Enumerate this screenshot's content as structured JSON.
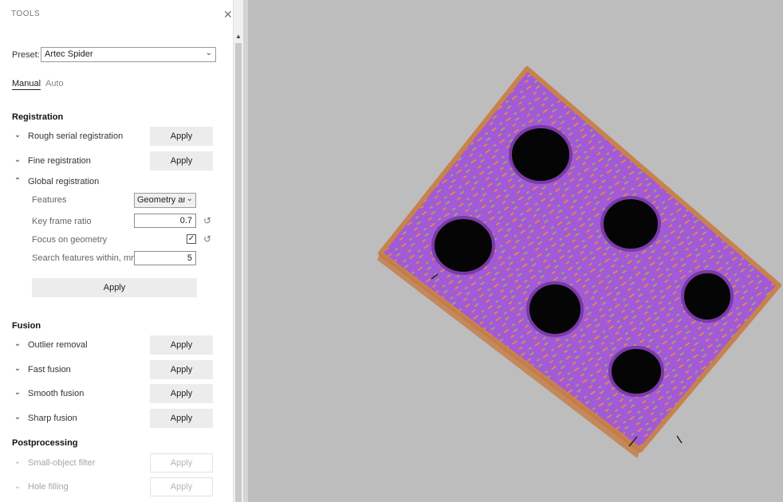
{
  "panel": {
    "title": "TOOLS",
    "close_icon": "close-icon",
    "preset_label": "Preset:",
    "preset_value": "Artec Spider",
    "tabs": [
      "Manual",
      "Auto"
    ],
    "active_tab": "Manual"
  },
  "registration": {
    "title": "Registration",
    "rough_label": "Rough serial registration",
    "fine_label": "Fine registration",
    "global_label": "Global registration",
    "features_label": "Features",
    "features_value": "Geometry an",
    "keyframe_label": "Key frame ratio",
    "keyframe_value": "0.7",
    "focus_label": "Focus on geometry",
    "focus_checked": true,
    "search_label": "Search features within, mm",
    "search_value": "5",
    "apply_label": "Apply"
  },
  "fusion": {
    "title": "Fusion",
    "items": [
      "Outlier removal",
      "Fast fusion",
      "Smooth fusion",
      "Sharp fusion"
    ]
  },
  "postprocessing": {
    "title": "Postprocessing",
    "items": [
      "Small-object filter",
      "Hole filling"
    ]
  },
  "buttons": {
    "apply": "Apply"
  },
  "icons": {
    "expand": "chevron-down-icon",
    "collapse": "chevron-up-icon",
    "reset": "reset-icon",
    "dropdown": "dropdown-caret-icon"
  },
  "colors": {
    "viewport_bg": "#bdbdbd",
    "mesh_purple": "#a25ad6",
    "mesh_orange": "#d78a55",
    "mesh_olive": "#a4a073"
  }
}
